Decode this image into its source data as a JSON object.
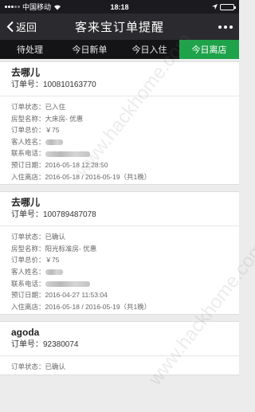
{
  "status_bar": {
    "carrier": "中国移动",
    "time": "18:18"
  },
  "nav": {
    "back_label": "返回",
    "title": "客来宝订单提醒"
  },
  "tabs": [
    {
      "label": "待处理",
      "active": false
    },
    {
      "label": "今日新单",
      "active": false
    },
    {
      "label": "今日入住",
      "active": false
    },
    {
      "label": "今日离店",
      "active": true
    }
  ],
  "orders": [
    {
      "source": "去哪儿",
      "order_no": "订单号：100810163770",
      "fields": {
        "status": "订单状态：已入住",
        "room": "房型名称：大床房- 优惠",
        "price": "订单总价：￥75",
        "guest_label": "客人姓名：",
        "phone_label": "联系电话：",
        "booked": "预订日期：2016-05-18 12:28:50",
        "stay": "入住离店：2016-05-18 / 2016-05-19（共1晚）"
      }
    },
    {
      "source": "去哪儿",
      "order_no": "订单号：100789487078",
      "fields": {
        "status": "订单状态：已确认",
        "room": "房型名称：阳光标准房- 优惠",
        "price": "订单总价：￥75",
        "guest_label": "客人姓名：",
        "phone_label": "联系电话：",
        "booked": "预订日期：2016-04-27 11:53:04",
        "stay": "入住离店：2016-05-18 / 2016-05-19（共1晚）"
      }
    },
    {
      "source": "agoda",
      "order_no": "订单号：92380074",
      "fields": {
        "status": "订单状态：已确认"
      }
    }
  ],
  "watermark": "www.hackhome.com",
  "colors": {
    "active_tab": "#1fa34a",
    "nav_bg": "#2b2b2f",
    "tab_bar_bg": "#141416"
  }
}
